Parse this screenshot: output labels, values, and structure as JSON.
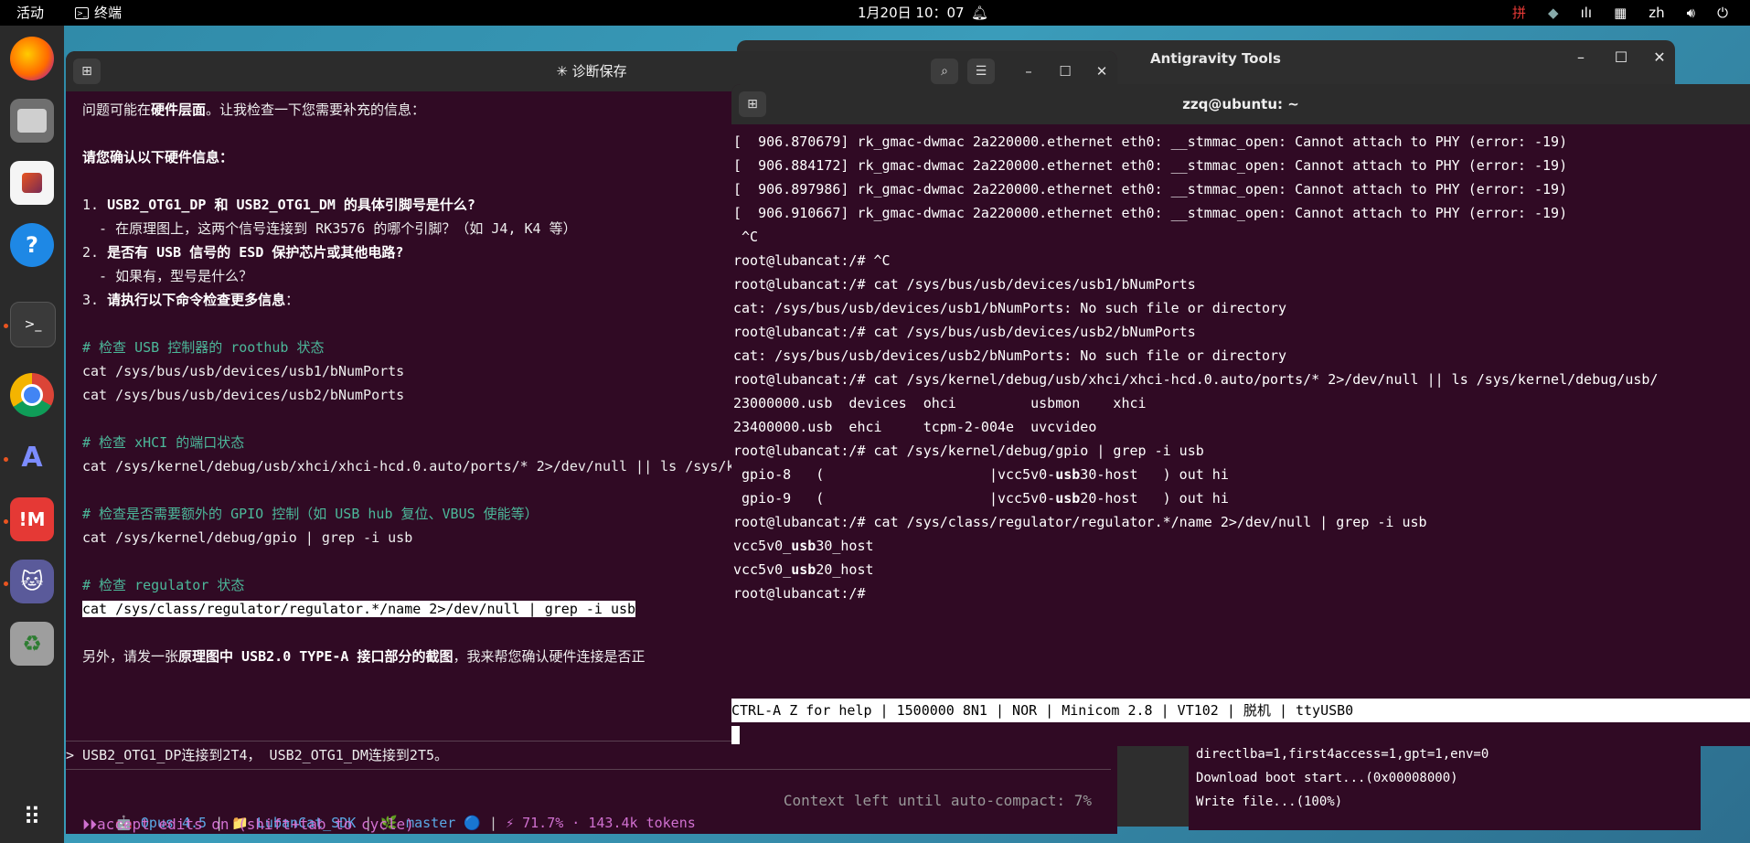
{
  "topbar": {
    "activities": "活动",
    "app_name": "终端",
    "clock": "1月20日 10：07",
    "tray_input": "zh"
  },
  "dock": {
    "items": [
      "firefox-icon",
      "files-icon",
      "app-center-icon",
      "help-icon",
      "terminal-icon",
      "chrome-icon",
      "antigravity-icon",
      "jetbrains-icon",
      "cat-icon",
      "trash-icon",
      "apps-grid-icon"
    ]
  },
  "bg_window": {
    "title": "Antigravity Tools",
    "lines": [
      "directlba=1,first4access=1,gpt=1,env=0",
      "Download boot start...(0x00008000)",
      "Write file...(100%)"
    ]
  },
  "main_window": {
    "title": "✳ 诊断保存",
    "lines": [
      {
        "segs": [
          {
            "t": "问题可能在",
            "c": ""
          },
          {
            "t": "硬件层面",
            "c": "bold"
          },
          {
            "t": "。让我检查一下您需要补充的信息：",
            "c": ""
          }
        ]
      },
      {
        "segs": [
          {
            "t": "请您确认以下硬件信息：",
            "c": "bold"
          }
        ]
      },
      {
        "segs": [
          {
            "t": "1. ",
            "c": ""
          },
          {
            "t": "USB2_OTG1_DP 和 USB2_OTG1_DM 的具体引脚号是什么?",
            "c": "bold"
          }
        ]
      },
      {
        "segs": [
          {
            "t": "  - 在原理图上，这两个信号连接到 RK3576 的哪个引脚？（如 J4, K4 等）",
            "c": ""
          }
        ]
      },
      {
        "segs": [
          {
            "t": "2. ",
            "c": ""
          },
          {
            "t": "是否有 USB 信号的 ESD 保护芯片或其他电路?",
            "c": "bold"
          }
        ]
      },
      {
        "segs": [
          {
            "t": "  - 如果有，型号是什么？",
            "c": ""
          }
        ]
      },
      {
        "segs": [
          {
            "t": "3. ",
            "c": ""
          },
          {
            "t": "请执行以下命令检查更多信息",
            "c": "bold"
          },
          {
            "t": "：",
            "c": ""
          }
        ]
      },
      {
        "segs": [
          {
            "t": "# 检查 USB 控制器的 roothub 状态",
            "c": "cmt"
          }
        ]
      },
      {
        "segs": [
          {
            "t": "cat /sys/bus/usb/devices/usb1/bNumPorts",
            "c": ""
          }
        ]
      },
      {
        "segs": [
          {
            "t": "cat /sys/bus/usb/devices/usb2/bNumPorts",
            "c": ""
          }
        ]
      },
      {
        "segs": [
          {
            "t": "# 检查 xHCI 的端口状态",
            "c": "cmt"
          }
        ]
      },
      {
        "segs": [
          {
            "t": "cat /sys/kernel/debug/usb/xhci/xhci-hcd.0.auto/ports/* 2>/dev/null || ls /sys/k",
            "c": ""
          }
        ]
      },
      {
        "segs": [
          {
            "t": "# 检查是否需要额外的 GPIO 控制（如 USB hub 复位、VBUS 使能等）",
            "c": "cmt"
          }
        ]
      },
      {
        "segs": [
          {
            "t": "cat /sys/kernel/debug/gpio | grep -i usb",
            "c": ""
          }
        ]
      },
      {
        "segs": [
          {
            "t": "# 检查 regulator 状态",
            "c": "cmt"
          }
        ]
      },
      {
        "segs": [
          {
            "t": "cat /sys/class/regulator/regulator.*/name 2>/dev/null | grep -i usb",
            "c": "hl"
          }
        ]
      },
      {
        "segs": [
          {
            "t": "另外，请发一张",
            "c": ""
          },
          {
            "t": "原理图中 USB2.0 TYPE-A 接口部分的截图",
            "c": "bold"
          },
          {
            "t": "，我来帮您确认硬件连接是否正",
            "c": ""
          }
        ]
      }
    ],
    "prompt": "> USB2_OTG1_DP连接到2T4， USB2_OTG1_DM连接到2T5。",
    "status": {
      "model": "🤖 Opus 4.5",
      "sep1": " | ",
      "project": "📁 LubanCat_SDK",
      "sep2": " | ",
      "branch": "🌿 master 🔵",
      "sep3": " | ",
      "usage": "⚡ 71.7% · 143.4k tokens",
      "context": "Context left until auto-compact: 7%"
    },
    "accept": "accept edits on (shift+tab to cycle)"
  },
  "minicom": {
    "title": "zzq@ubuntu: ~",
    "lines": [
      "[  906.870679] rk_gmac-dwmac 2a220000.ethernet eth0: __stmmac_open: Cannot attach to PHY (error: -19)",
      "[  906.884172] rk_gmac-dwmac 2a220000.ethernet eth0: __stmmac_open: Cannot attach to PHY (error: -19)",
      "[  906.897986] rk_gmac-dwmac 2a220000.ethernet eth0: __stmmac_open: Cannot attach to PHY (error: -19)",
      "[  906.910667] rk_gmac-dwmac 2a220000.ethernet eth0: __stmmac_open: Cannot attach to PHY (error: -19)",
      " ^C",
      "root@lubancat:/# ^C",
      "root@lubancat:/# cat /sys/bus/usb/devices/usb1/bNumPorts",
      "cat: /sys/bus/usb/devices/usb1/bNumPorts: No such file or directory",
      "root@lubancat:/# cat /sys/bus/usb/devices/usb2/bNumPorts",
      "cat: /sys/bus/usb/devices/usb2/bNumPorts: No such file or directory",
      "root@lubancat:/# cat /sys/kernel/debug/usb/xhci/xhci-hcd.0.auto/ports/* 2>/dev/null || ls /sys/kernel/debug/usb/",
      "23000000.usb  devices  ohci         usbmon    xhci",
      "23400000.usb  ehci     tcpm-2-004e  uvcvideo",
      "root@lubancat:/# cat /sys/kernel/debug/gpio | grep -i usb",
      " gpio-8   (                    |vcc5v0-usb30-host   ) out hi",
      " gpio-9   (                    |vcc5v0-usb20-host   ) out hi",
      "root@lubancat:/# cat /sys/class/regulator/regulator.*/name 2>/dev/null | grep -i usb",
      "vcc5v0_usb30_host",
      "vcc5v0_usb20_host",
      "root@lubancat:/#"
    ],
    "status": "CTRL-A Z for help | 1500000 8N1 | NOR | Minicom 2.8 | VT102 | 脱机 | ttyUSB0"
  }
}
